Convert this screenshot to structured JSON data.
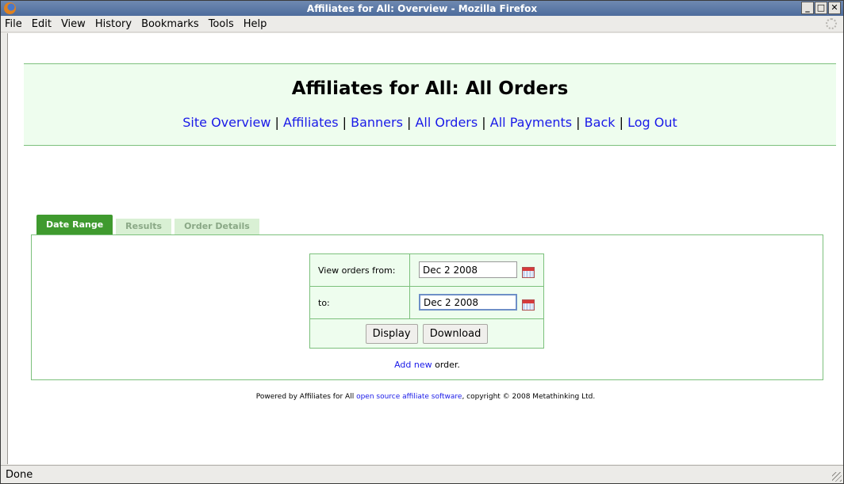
{
  "window": {
    "title": "Affiliates for All: Overview - Mozilla Firefox"
  },
  "menu": [
    "File",
    "Edit",
    "View",
    "History",
    "Bookmarks",
    "Tools",
    "Help"
  ],
  "page": {
    "title": "Affiliates for All: All Orders",
    "nav": [
      "Site Overview",
      "Affiliates",
      "Banners",
      "All Orders",
      "All Payments",
      "Back",
      "Log Out"
    ]
  },
  "tabs": [
    {
      "label": "Date Range",
      "active": true
    },
    {
      "label": "Results",
      "active": false
    },
    {
      "label": "Order Details",
      "active": false
    }
  ],
  "form": {
    "from_label": "View orders from:",
    "from_value": "Dec 2 2008",
    "to_label": "to:",
    "to_value": "Dec 2 2008",
    "display_button": "Display",
    "download_button": "Download"
  },
  "add_new": {
    "link": "Add new",
    "suffix": " order."
  },
  "footer": {
    "prefix": "Powered by Affiliates for All ",
    "link": "open source affiliate software",
    "suffix": ", copyright © 2008 Metathinking Ltd."
  },
  "status": "Done",
  "colors": {
    "accent_green": "#3f9a2e",
    "panel_bg": "#eefdee",
    "link": "#1a1ae8"
  }
}
